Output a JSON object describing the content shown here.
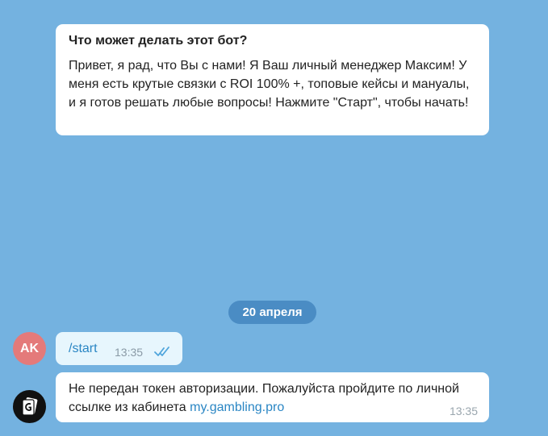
{
  "bot_info": {
    "title": "Что может делать этот бот?",
    "text": "Привет, я рад, что Вы с нами! Я Ваш личный менеджер Максим! У меня есть крутые связки с ROI 100% +, топовые кейсы и мануалы, и я готов решать любые вопросы! Нажмите \"Старт\", чтобы начать!"
  },
  "date_separator": "20 апреля",
  "outgoing": {
    "avatar_initials": "AK",
    "text": "/start",
    "time": "13:35",
    "status_icon": "double-check-icon"
  },
  "incoming": {
    "avatar_icon": "bot-logo-icon",
    "text": "Не передан токен авторизации. Пожалуйста пройдите по личной ссылке из кабинета",
    "link_text": "my.gambling.pro",
    "time": "13:35"
  },
  "colors": {
    "background": "#74b2e0",
    "date_pill": "#4a8cc4",
    "outgoing_bubble": "#e7f6fd",
    "link": "#2a86c4",
    "user_avatar": "#e47a7a"
  }
}
